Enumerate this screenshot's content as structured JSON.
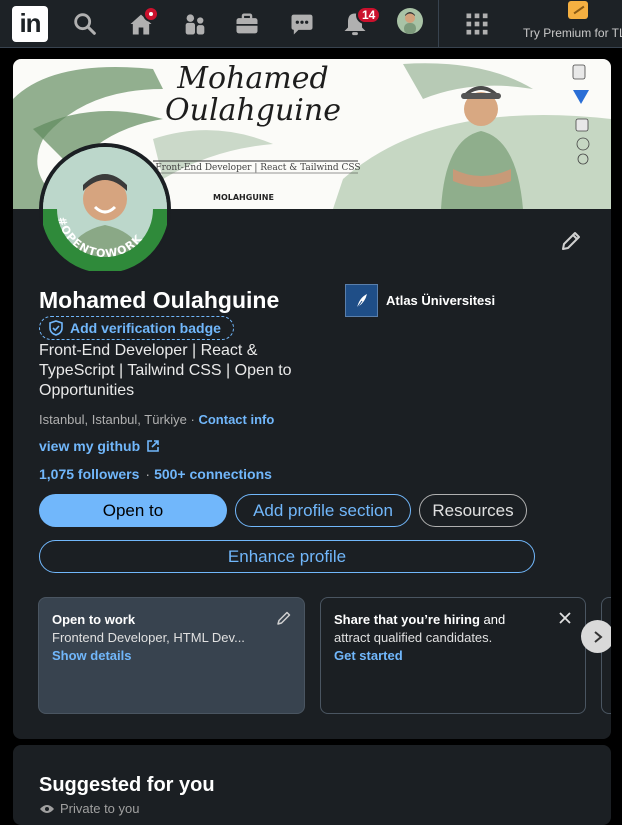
{
  "nav": {
    "logo": "in",
    "notifications_count": "14",
    "premium_label": "Try Premium for TL"
  },
  "banner": {
    "name_line1": "Mohamed",
    "name_line2": "Oulahguine",
    "subtitle": "Front-End Developer | React & Tailwind CSS",
    "brand": "MOLAHGUINE"
  },
  "avatar": {
    "ring_text": "#OPENTOWORK"
  },
  "profile": {
    "name": "Mohamed Oulahguine",
    "verify_badge": "Add verification badge",
    "headline": "Front-End Developer | React & TypeScript | Tailwind CSS | Open to Opportunities",
    "location": "Istanbul, Istanbul, Türkiye",
    "location_sep": " · ",
    "contact_info": "Contact info",
    "github_link": "view my github",
    "followers": "1,075 followers",
    "stats_sep": "·",
    "connections": "500+ connections",
    "education": "Atlas Üniversitesi"
  },
  "actions": {
    "open_to": "Open to",
    "add_section": "Add profile section",
    "resources": "Resources",
    "enhance": "Enhance profile"
  },
  "cards": {
    "open_to_work_title": "Open to work",
    "open_to_work_text": "Frontend Developer, HTML Dev...",
    "open_to_work_link": "Show details",
    "hiring_title": "Share that you’re hiring",
    "hiring_title_rest": " and",
    "hiring_text": "attract qualified candidates.",
    "hiring_link": "Get started"
  },
  "suggested": {
    "title": "Suggested for you",
    "privacy": "Private to you"
  },
  "colors": {
    "accent": "#71b7fb",
    "open_to_work_green": "#2f8a3a",
    "notification_red": "#cb112d",
    "card_bg": "#1b1f23"
  }
}
